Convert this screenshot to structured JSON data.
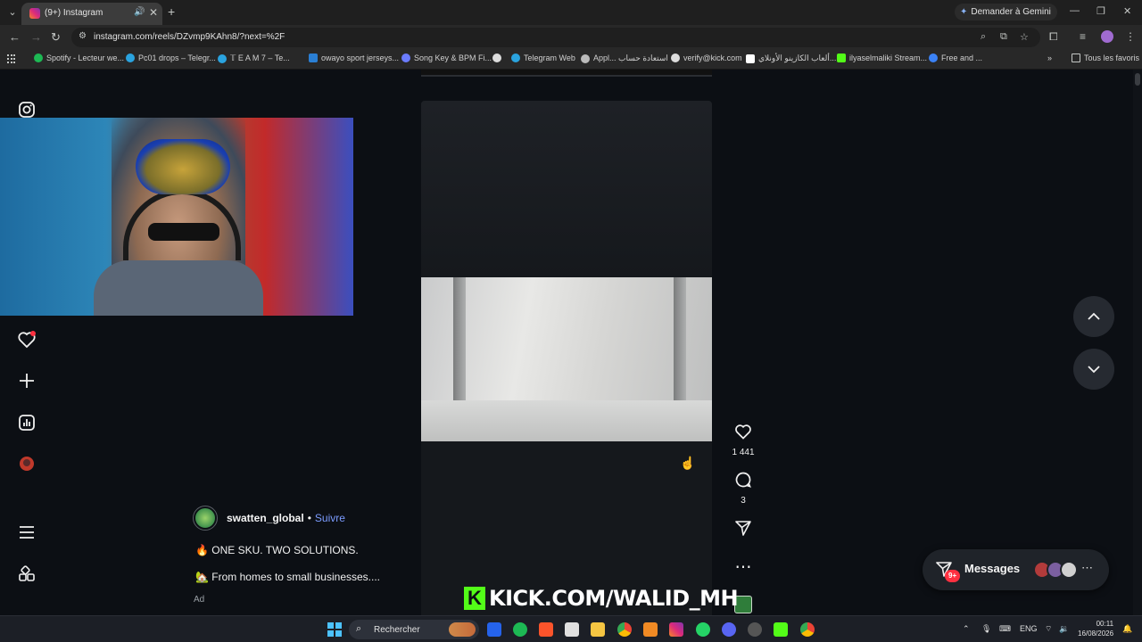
{
  "browser": {
    "tab_title": "(9+) Instagram",
    "gemini_label": "Demander à Gemini",
    "url": "instagram.com/reels/DZvmp9KAhn8/?next=%2F",
    "bookmarks": [
      {
        "label": "Spotify - Lecteur we...",
        "color": "#1db954"
      },
      {
        "label": "Pc01 drops – Telegr...",
        "color": "#2aa3df"
      },
      {
        "label": "𝕋 E A M 7 – Te...",
        "color": "#2aa3df"
      },
      {
        "label": "owayo sport jerseys...",
        "color": "#2a7fd4"
      },
      {
        "label": "Song Key & BPM Fi...",
        "color": "#6b7cff"
      },
      {
        "label": "Telegram Web",
        "color": "#2aa3df"
      },
      {
        "label": "Appl... استعادة حساب",
        "color": "#bbbbbb"
      },
      {
        "label": "verify@kick.com",
        "color": "#dddddd"
      },
      {
        "label": "ألعاب الكازينو الأونلاي...",
        "color": "#ffffff"
      },
      {
        "label": "ilyaselmaliki Stream...",
        "color": "#53fc18"
      },
      {
        "label": "Free and ...",
        "color": "#3b82f6"
      }
    ],
    "all_bookmarks": "Tous les favoris"
  },
  "reel": {
    "author": "swatten_global",
    "separator": "•",
    "follow": "Suivre",
    "caption_1": "🔥 ONE SKU. TWO SOLUTIONS.",
    "caption_2": "🏡 From homes to small businesses....",
    "ad_label": "Ad",
    "likes": "1 441",
    "comments": "3",
    "stream_overlay": "KICK.COM/WALID_MH",
    "stream_k": "K"
  },
  "messages": {
    "label": "Messages",
    "badge": "9+"
  },
  "taskbar": {
    "search_placeholder": "Rechercher",
    "lang": "ENG",
    "time": "00:11",
    "date": "16/08/2026"
  },
  "icons": {
    "instagram": "instagram-logo-icon",
    "notifications": "heart-icon",
    "create": "plus-icon",
    "dashboard": "insights-icon",
    "profile": "profile-avatar",
    "more": "hamburger-menu-icon",
    "also_from_meta": "grid-icon"
  }
}
